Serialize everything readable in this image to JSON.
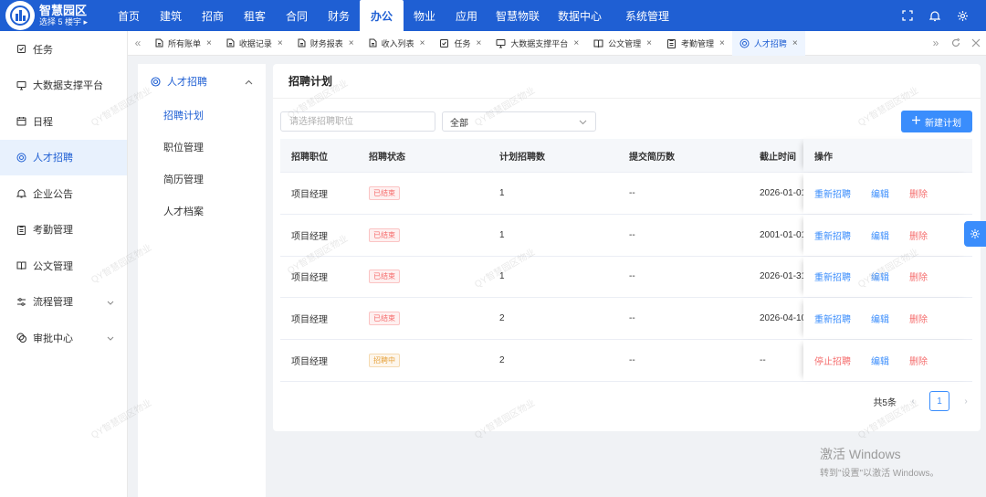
{
  "brand": {
    "title": "智慧园区",
    "subtitle": "选择 5 楼宇 ▸"
  },
  "topnav": [
    "首页",
    "建筑",
    "招商",
    "租客",
    "合同",
    "财务",
    "办公",
    "物业",
    "应用",
    "智慧物联",
    "数据中心",
    "系统管理"
  ],
  "topnav_active": "办公",
  "sidebar": {
    "items": [
      {
        "label": "任务",
        "icon": "task-icon"
      },
      {
        "label": "大数据支撑平台",
        "icon": "monitor-icon"
      },
      {
        "label": "日程",
        "icon": "calendar-icon"
      },
      {
        "label": "人才招聘",
        "icon": "target-icon",
        "active": true
      },
      {
        "label": "企业公告",
        "icon": "bell-icon"
      },
      {
        "label": "考勤管理",
        "icon": "clipboard-icon"
      },
      {
        "label": "公文管理",
        "icon": "book-icon"
      },
      {
        "label": "流程管理",
        "icon": "sliders-icon",
        "expandable": true
      },
      {
        "label": "审批中心",
        "icon": "approval-icon",
        "expandable": true
      }
    ]
  },
  "tabs": [
    {
      "label": "所有账单",
      "icon": "file-icon"
    },
    {
      "label": "收据记录",
      "icon": "file-icon"
    },
    {
      "label": "财务报表",
      "icon": "file-icon"
    },
    {
      "label": "收入列表",
      "icon": "file-icon"
    },
    {
      "label": "任务",
      "icon": "task-icon"
    },
    {
      "label": "大数据支撑平台",
      "icon": "monitor-icon"
    },
    {
      "label": "公文管理",
      "icon": "book-icon"
    },
    {
      "label": "考勤管理",
      "icon": "clipboard-icon"
    },
    {
      "label": "人才招聘",
      "icon": "target-icon",
      "active": true
    }
  ],
  "submenu": {
    "title": "人才招聘",
    "items": [
      "招聘计划",
      "职位管理",
      "简历管理",
      "人才档案"
    ],
    "active": "招聘计划"
  },
  "panel": {
    "title": "招聘计划",
    "search_placeholder": "请选择招聘职位",
    "status_select": "全部",
    "new_button": "新建计划"
  },
  "table": {
    "headers": [
      "招聘职位",
      "招聘状态",
      "计划招聘数",
      "提交简历数",
      "截止时间",
      "操作"
    ],
    "rows": [
      {
        "position": "项目经理",
        "status": "已结束",
        "status_type": "ended",
        "planned": "1",
        "resumes": "--",
        "deadline": "2026-01-01",
        "actions": [
          "重新招聘",
          "编辑",
          "删除"
        ]
      },
      {
        "position": "项目经理",
        "status": "已结束",
        "status_type": "ended",
        "planned": "1",
        "resumes": "--",
        "deadline": "2001-01-01",
        "actions": [
          "重新招聘",
          "编辑",
          "删除"
        ]
      },
      {
        "position": "项目经理",
        "status": "已结束",
        "status_type": "ended",
        "planned": "1",
        "resumes": "--",
        "deadline": "2026-01-31",
        "actions": [
          "重新招聘",
          "编辑",
          "删除"
        ]
      },
      {
        "position": "项目经理",
        "status": "已结束",
        "status_type": "ended",
        "planned": "2",
        "resumes": "--",
        "deadline": "2026-04-10",
        "actions": [
          "重新招聘",
          "编辑",
          "删除"
        ]
      },
      {
        "position": "项目经理",
        "status": "招聘中",
        "status_type": "active",
        "planned": "2",
        "resumes": "--",
        "deadline": "--",
        "actions": [
          "停止招聘",
          "编辑",
          "删除"
        ]
      }
    ]
  },
  "pagination": {
    "total": "共5条",
    "current": "1"
  },
  "watermark_text": "QY智慧园区物业",
  "activation": {
    "line1": "激活 Windows",
    "line2": "转到\"设置\"以激活 Windows。"
  },
  "colors": {
    "primary": "#1f5fd3",
    "accent": "#3a8dfc",
    "danger": "#f56c6c",
    "warning": "#e6a23c"
  }
}
